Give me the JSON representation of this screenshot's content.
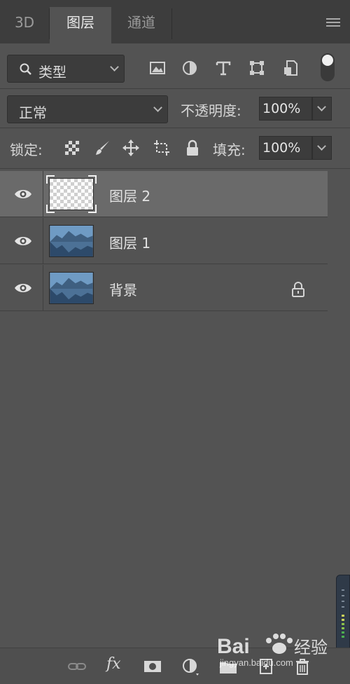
{
  "tabs": [
    {
      "label": "3D",
      "active": false
    },
    {
      "label": "图层",
      "active": true
    },
    {
      "label": "通道",
      "active": false
    }
  ],
  "filter": {
    "kind_label": "类型",
    "icons": [
      "image-filter-icon",
      "adjustment-filter-icon",
      "type-filter-icon",
      "shape-filter-icon",
      "smart-object-filter-icon"
    ],
    "toggle_on": true
  },
  "blend": {
    "mode": "正常",
    "opacity_label": "不透明度:",
    "opacity_value": "100%"
  },
  "lock": {
    "label": "锁定:",
    "icons": [
      "lock-transparent-pixels-icon",
      "lock-image-pixels-icon",
      "lock-position-icon",
      "lock-artboard-icon",
      "lock-all-icon"
    ],
    "fill_label": "填充:",
    "fill_value": "100%"
  },
  "layers": [
    {
      "name": "图层 2",
      "selected": true,
      "transparent": true,
      "locked": false
    },
    {
      "name": "图层 1",
      "selected": false,
      "transparent": false,
      "locked": false
    },
    {
      "name": "背景",
      "selected": false,
      "transparent": false,
      "locked": true
    }
  ],
  "bottom_icons": [
    "link-layers-icon",
    "fx-icon",
    "add-mask-icon",
    "new-adjustment-layer-icon",
    "new-group-icon",
    "new-layer-icon",
    "delete-layer-icon"
  ],
  "bottom_fx_text": "fx",
  "watermark": {
    "brand": "Bai",
    "suffix": "经验",
    "url": "jingyan.baidu.com"
  },
  "colors": {
    "panel": "#535353",
    "selected_row": "#6a6a6a",
    "tab_bar": "#3d3d3d"
  }
}
